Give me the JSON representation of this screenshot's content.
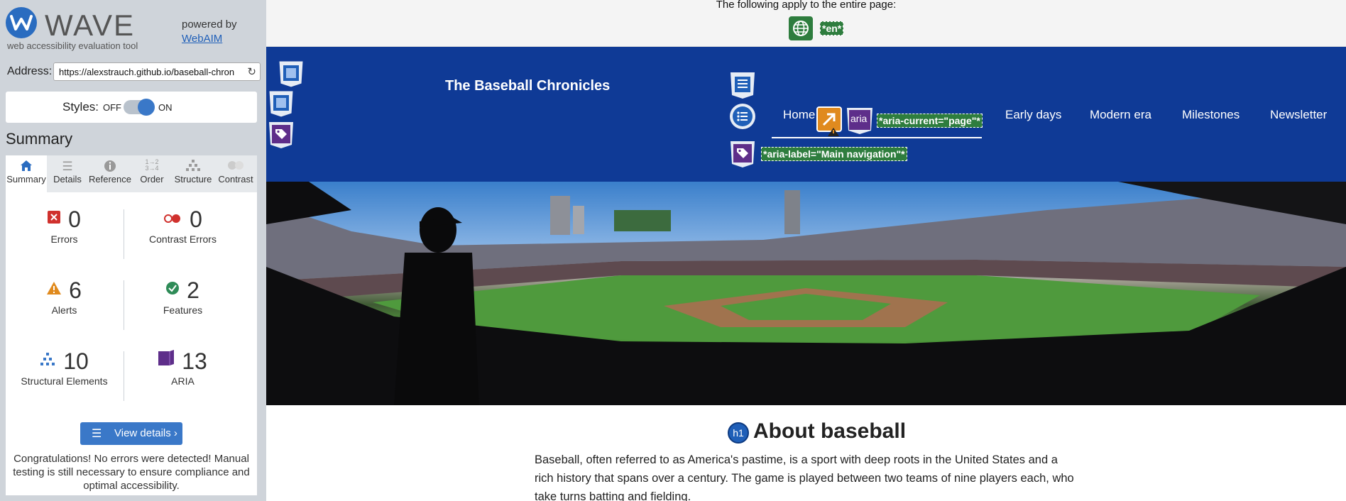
{
  "wave": {
    "logo_text": "WAVE",
    "tagline": "web accessibility evaluation tool",
    "powered_by": "powered by",
    "webaim_link": "WebAIM",
    "address_label": "Address:",
    "address_value": "https://alexstrauch.github.io/baseball-chron",
    "styles_label": "Styles:",
    "styles_off": "OFF",
    "styles_on": "ON",
    "summary_heading": "Summary",
    "tabs": [
      {
        "label": "Summary",
        "icon": "home-icon"
      },
      {
        "label": "Details",
        "icon": "list-icon"
      },
      {
        "label": "Reference",
        "icon": "info-icon"
      },
      {
        "label": "Order",
        "icon": "order-icon"
      },
      {
        "label": "Structure",
        "icon": "structure-icon"
      },
      {
        "label": "Contrast",
        "icon": "contrast-icon"
      }
    ],
    "stats": [
      {
        "value": "0",
        "label": "Errors",
        "icon": "error-icon",
        "color": "#d0312d"
      },
      {
        "value": "0",
        "label": "Contrast Errors",
        "icon": "contrast-error-icon",
        "color": "#d0312d"
      },
      {
        "value": "6",
        "label": "Alerts",
        "icon": "alert-icon",
        "color": "#e08a1e"
      },
      {
        "value": "2",
        "label": "Features",
        "icon": "feature-icon",
        "color": "#2e8b57"
      },
      {
        "value": "10",
        "label": "Structural Elements",
        "icon": "structure-icon",
        "color": "#3a78c8"
      },
      {
        "value": "13",
        "label": "ARIA",
        "icon": "aria-icon",
        "color": "#5e2e8a"
      }
    ],
    "view_details": "View details ›",
    "congrats": "Congratulations! No errors were detected! Manual testing is still necessary to ensure compliance and optimal accessibility."
  },
  "page": {
    "apply_note": "The following apply to the entire page:",
    "lang_tag": "*en*",
    "site_title": "The Baseball Chronicles",
    "nav": {
      "home": "Home",
      "aria_badge": "aria",
      "aria_current_tag": "*aria-current=\"page\"*",
      "aria_label_tag": "*aria-label=\"Main navigation\"*",
      "links": [
        "Early days",
        "Modern era",
        "Milestones",
        "Newsletter"
      ]
    },
    "h1_badge": "h1",
    "heading": "About baseball",
    "paragraph": "Baseball, often referred to as America's pastime, is a sport with deep roots in the United States and a rich history that spans over a century. The game is played between two teams of nine players each, who take turns batting and fielding."
  }
}
